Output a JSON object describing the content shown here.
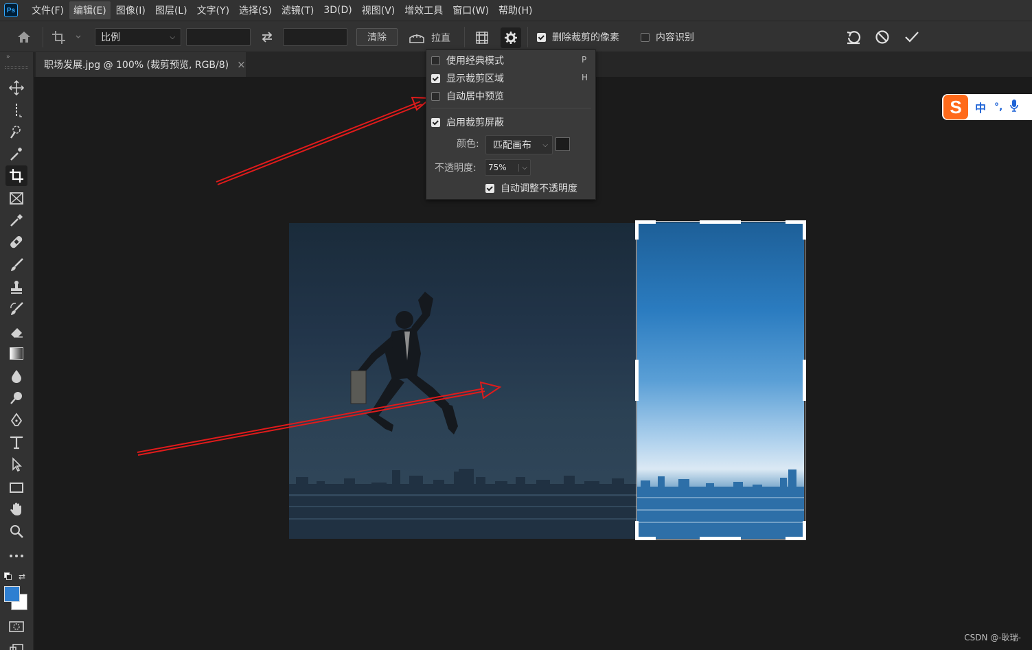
{
  "app": {
    "logo": "Ps"
  },
  "menu": [
    "文件(F)",
    "编辑(E)",
    "图像(I)",
    "图层(L)",
    "文字(Y)",
    "选择(S)",
    "滤镜(T)",
    "3D(D)",
    "视图(V)",
    "增效工具",
    "窗口(W)",
    "帮助(H)"
  ],
  "options": {
    "ratio_select": "比例",
    "width_value": "",
    "height_value": "",
    "clear_label": "清除",
    "straighten_label": "拉直",
    "delete_cropped_label": "删除裁剪的像素",
    "delete_cropped_checked": true,
    "content_aware_label": "内容识别",
    "content_aware_checked": false
  },
  "document": {
    "tab_title": "职场发展.jpg @ 100% (裁剪预览, RGB/8)",
    "close_glyph": "×"
  },
  "settings_menu": {
    "classic_mode": {
      "label": "使用经典模式",
      "shortcut": "P",
      "checked": false
    },
    "show_crop_area": {
      "label": "显示裁剪区域",
      "shortcut": "H",
      "checked": true
    },
    "auto_center": {
      "label": "自动居中预览",
      "checked": false
    },
    "enable_shield": {
      "label": "启用裁剪屏蔽",
      "checked": true
    },
    "color_label": "颜色:",
    "color_value": "匹配画布",
    "opacity_label": "不透明度:",
    "opacity_value": "75%",
    "auto_adjust_label": "自动调整不透明度",
    "auto_adjust_checked": true
  },
  "ime": {
    "mode": "中",
    "punct": "°,"
  },
  "watermark": "CSDN @-耿瑞-",
  "colors": {
    "foreground": "#2f7fd1",
    "background": "#ffffff",
    "annotation_arrow": "#e01b1b"
  }
}
